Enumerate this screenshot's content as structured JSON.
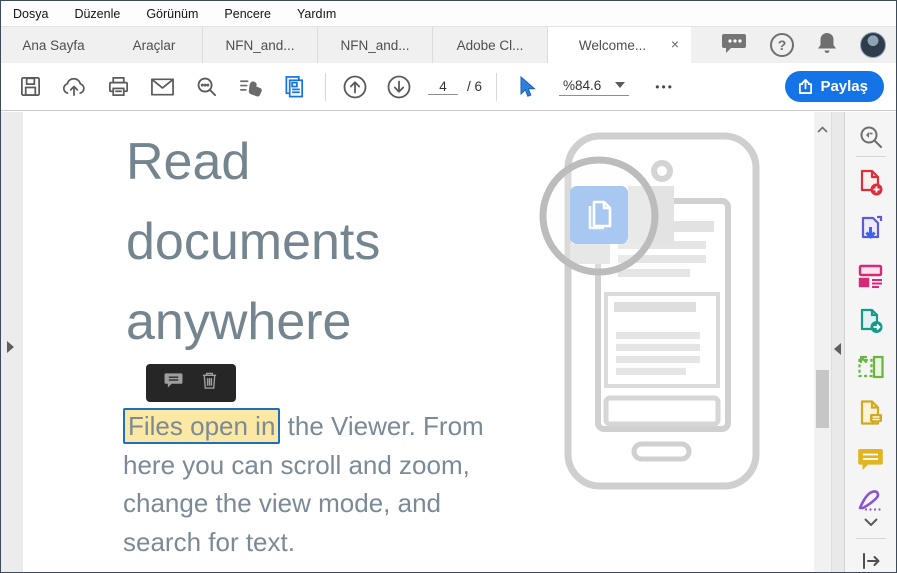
{
  "menu_bar": {
    "items": [
      "Dosya",
      "Düzenle",
      "Görünüm",
      "Pencere",
      "Yardım"
    ]
  },
  "tab_bar": {
    "home_tabs": [
      {
        "label": "Ana Sayfa"
      },
      {
        "label": "Araçlar"
      }
    ],
    "doc_tabs": [
      {
        "label": "NFN_and..."
      },
      {
        "label": "NFN_and..."
      },
      {
        "label": "Adobe Cl..."
      },
      {
        "label": "Welcome...",
        "active": true
      }
    ],
    "close_glyph": "×",
    "help_glyph": "?",
    "right_icons": [
      "feedback-bubble",
      "help",
      "notifications",
      "avatar"
    ]
  },
  "toolbar": {
    "page_current": "4",
    "page_total": "/ 6",
    "zoom_level": "%84.6",
    "more_options": "•••",
    "share_label": "Paylaş",
    "icons": [
      "save",
      "cloud-upload",
      "print",
      "email",
      "search",
      "touch-swipe",
      "page-copy",
      "previous-page",
      "next-page",
      "select-cursor",
      "zoom-dropdown",
      "more-options"
    ]
  },
  "document": {
    "heading": "Read documents anywhere",
    "paragraph": {
      "highlight": "Files open in",
      "rest_line1": " the Viewer. From",
      "line2": "here you can scroll and zoom,",
      "line3": "change the view mode, and",
      "line4": "search for text."
    },
    "annotation_popup_icons": [
      "comment",
      "delete"
    ]
  },
  "sidebar": {
    "tools": [
      "search-tools",
      "create-pdf",
      "export-pdf",
      "edit-pdf",
      "send-pdf",
      "scan-ocr",
      "page-comment",
      "comment",
      "fill-sign",
      "more-tools",
      "open-pane"
    ]
  },
  "colors": {
    "accent_blue": "#1473e6",
    "highlight_yellow": "#fbe8a3",
    "selection_blue": "#1e6fc0",
    "heading_gray_blue": "#74858f",
    "popup_dark": "#262626"
  }
}
